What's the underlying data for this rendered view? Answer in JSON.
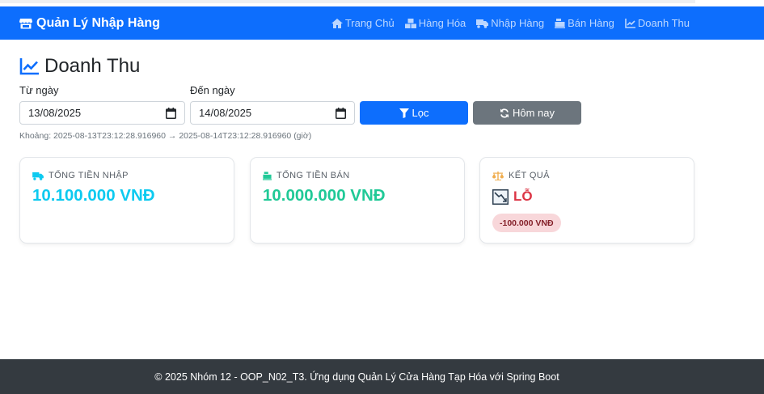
{
  "brand": {
    "title": "Quản Lý Nhập Hàng",
    "icon": "store-icon"
  },
  "nav": [
    {
      "label": "Trang Chủ",
      "icon": "home-icon"
    },
    {
      "label": "Hàng Hóa",
      "icon": "boxes-icon"
    },
    {
      "label": "Nhập Hàng",
      "icon": "truck-icon"
    },
    {
      "label": "Bán Hàng",
      "icon": "cash-register-icon"
    },
    {
      "label": "Doanh Thu",
      "icon": "chart-line-icon"
    }
  ],
  "page": {
    "title": "Doanh Thu",
    "icon": "chart-line-icon"
  },
  "filter": {
    "from_label": "Từ ngày",
    "from_value": "13/08/2025",
    "to_label": "Đến ngày",
    "to_value": "14/08/2025",
    "filter_button": "Lọc",
    "today_button": "Hôm nay",
    "range_text": "Khoảng: 2025-08-13T23:12:28.916960 → 2025-08-14T23:12:28.916960 (giờ)"
  },
  "cards": [
    {
      "label": "TỔNG TIỀN NHẬP",
      "value": "10.100.000 VNĐ",
      "icon": "truck-icon",
      "color": "#0dcaf0"
    },
    {
      "label": "TỔNG TIỀN BÁN",
      "value": "10.000.000 VNĐ",
      "icon": "cash-register-icon",
      "color": "#20c997"
    },
    {
      "label": "KẾT QUẢ",
      "result": "LỖ",
      "badge": "-100.000 VNĐ",
      "icon": "balance-scale-icon",
      "result_icon": "chart-decreasing-icon",
      "color": "#dc3545"
    }
  ],
  "footer": {
    "text": "© 2025 Nhóm 12 - OOP_N02_T3. Ứng dụng Quản Lý Cửa Hàng Tạp Hóa với Spring Boot"
  },
  "colors": {
    "primary": "#0d6efd",
    "secondary": "#6c757d",
    "footer_bg": "#343a40"
  }
}
